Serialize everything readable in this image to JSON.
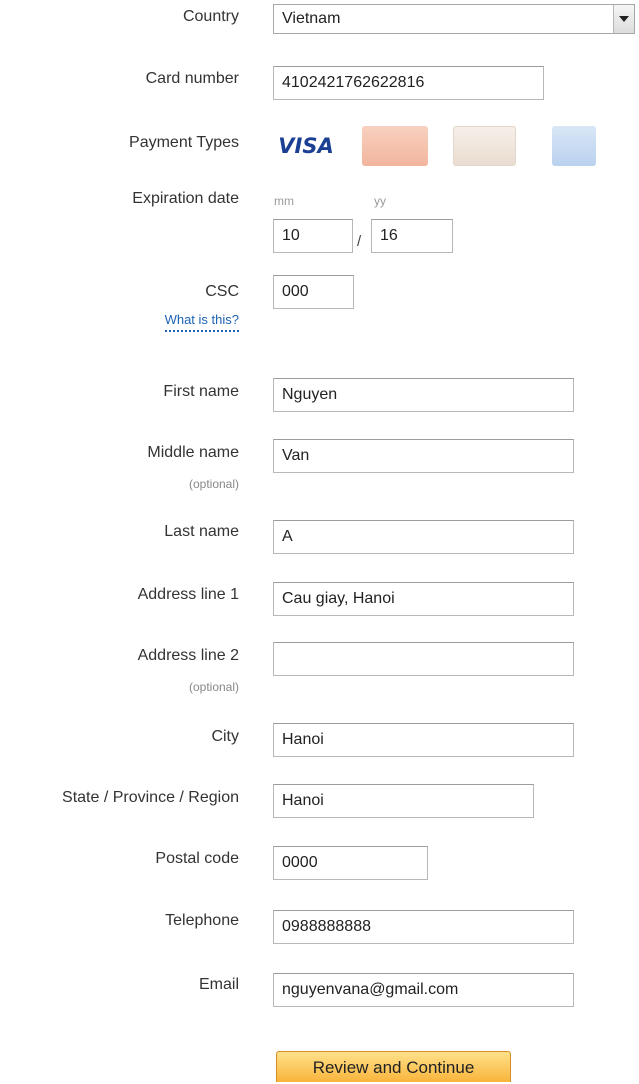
{
  "labels": {
    "country": "Country",
    "card_number": "Card number",
    "payment_types": "Payment Types",
    "expiration_date": "Expiration date",
    "csc": "CSC",
    "what_is_this": "What is this?",
    "first_name": "First name",
    "middle_name": "Middle name",
    "last_name": "Last name",
    "address_line_1": "Address line 1",
    "address_line_2": "Address line 2",
    "city": "City",
    "state": "State / Province / Region",
    "postal_code": "Postal code",
    "telephone": "Telephone",
    "email": "Email",
    "optional": "(optional)"
  },
  "hints": {
    "mm": "mm",
    "yy": "yy",
    "slash": "/"
  },
  "values": {
    "country": "Vietnam",
    "card_number": "4102421762622816",
    "exp_month": "10",
    "exp_year": "16",
    "csc": "000",
    "first_name": "Nguyen",
    "middle_name": "Van",
    "last_name": "A",
    "address_line_1": "Cau giay, Hanoi",
    "address_line_2": "",
    "city": "Hanoi",
    "state": "Hanoi",
    "postal_code": "0000",
    "telephone": "0988888888",
    "email": "nguyenvana@gmail.com"
  },
  "payment_types": {
    "visa": "VISA",
    "icons": [
      "visa-icon",
      "mastercard-icon",
      "discover-icon",
      "amex-icon"
    ]
  },
  "submit_label": "Review and Continue",
  "colors": {
    "link": "#1e62b4",
    "visa": "#1a3f93",
    "button_top": "#ffe18a",
    "button_bottom": "#f9b43b"
  }
}
